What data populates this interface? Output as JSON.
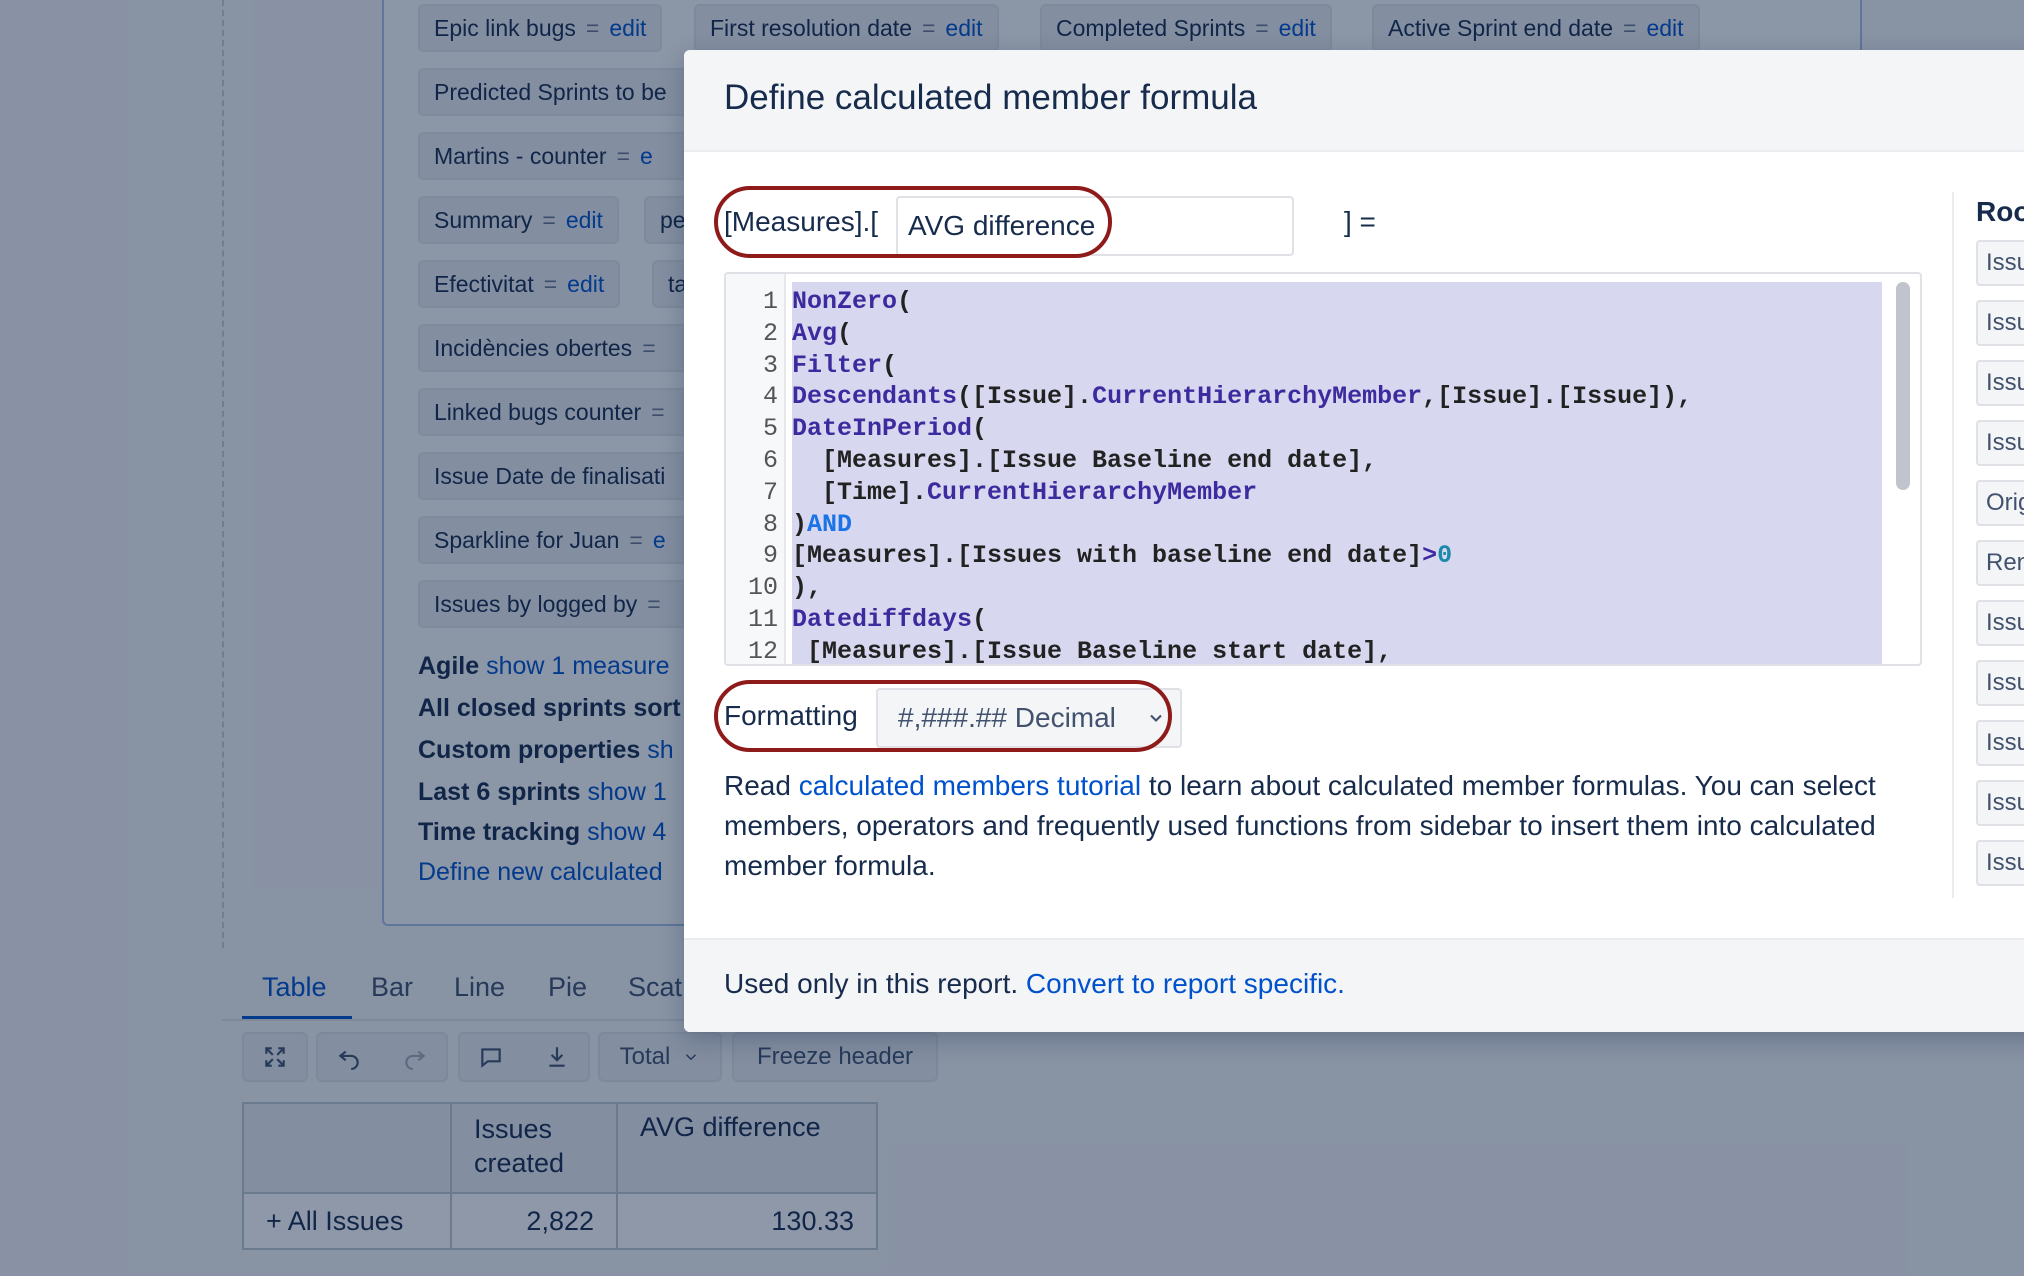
{
  "background": {
    "measure_chips": [
      {
        "label": "Epic link bugs",
        "edit": "edit"
      },
      {
        "label": "First resolution date",
        "edit": "edit"
      },
      {
        "label": "Completed Sprints",
        "edit": "edit"
      },
      {
        "label": "Active Sprint end date",
        "edit": "edit"
      },
      {
        "label": "Predicted Sprints to be"
      },
      {
        "label": "Martins - counter",
        "edit": "e"
      },
      {
        "label": "Summary",
        "edit": "edit"
      },
      {
        "label": "pe"
      },
      {
        "label": "Efectivitat",
        "edit": "edit"
      },
      {
        "label": "ta"
      },
      {
        "label": "Incidències obertes"
      },
      {
        "label": "Linked bugs counter"
      },
      {
        "label": "Issue Date de finalisati"
      },
      {
        "label": "Sparkline for Juan",
        "edit": "e"
      },
      {
        "label": "Issues by logged by"
      }
    ],
    "groups": [
      {
        "name": "Agile",
        "link": "show 1 measure"
      },
      {
        "name": "All closed sprints sort",
        "link": ""
      },
      {
        "name": "Custom properties",
        "link": "sh"
      },
      {
        "name": "Last 6 sprints",
        "link": "show 1"
      },
      {
        "name": "Time tracking",
        "link": "show 4"
      }
    ],
    "define_new": "Define new calculated",
    "tabs": [
      "Table",
      "Bar",
      "Line",
      "Pie",
      "Scat"
    ],
    "active_tab": "Table",
    "toolbar": {
      "total_label": "Total",
      "freeze_label": "Freeze header"
    },
    "table": {
      "headers": [
        "",
        "Issues\ncreated",
        "AVG difference"
      ],
      "rows": [
        [
          "+ All Issues",
          "2,822",
          "130.33"
        ]
      ]
    }
  },
  "modal": {
    "title": "Define calculated member formula",
    "prefix": "[Measures].[",
    "name_value": "AVG difference",
    "suffix": "] =",
    "code_lines": [
      [
        {
          "t": "NonZero",
          "c": "fn"
        },
        {
          "t": "("
        }
      ],
      [
        {
          "t": "Avg",
          "c": "fn"
        },
        {
          "t": "("
        }
      ],
      [
        {
          "t": "Filter",
          "c": "fn"
        },
        {
          "t": "("
        }
      ],
      [
        {
          "t": "Descendants",
          "c": "fn"
        },
        {
          "t": "([Issue]."
        },
        {
          "t": "CurrentHierarchyMember",
          "c": "fn"
        },
        {
          "t": ",[Issue].[Issue]),"
        }
      ],
      [
        {
          "t": "DateInPeriod",
          "c": "fn"
        },
        {
          "t": "("
        }
      ],
      [
        {
          "t": "  [Measures].[Issue Baseline end date],"
        }
      ],
      [
        {
          "t": "  [Time]."
        },
        {
          "t": "CurrentHierarchyMember",
          "c": "fn"
        }
      ],
      [
        {
          "t": ")"
        },
        {
          "t": "AND",
          "c": "kw"
        }
      ],
      [
        {
          "t": "[Measures].[Issues with baseline end date]"
        },
        {
          "t": ">",
          "c": "fn"
        },
        {
          "t": "0",
          "c": "nb"
        }
      ],
      [
        {
          "t": "),"
        }
      ],
      [
        {
          "t": "Datediffdays",
          "c": "fn"
        },
        {
          "t": "("
        }
      ],
      [
        {
          "t": " [Measures].[Issue Baseline start date],"
        }
      ]
    ],
    "formatting_label": "Formatting",
    "formatting_value": "#,###.## Decimal",
    "help_prefix": "Read ",
    "help_link": "calculated members tutorial",
    "help_suffix": " to learn about calculated member formulas. You can select members, operators and frequently used functions from sidebar to insert them into calculated member formula.",
    "footer_text": "Used only in this report.",
    "footer_link": "Convert to report specific.",
    "sidebar_title": "Roo",
    "sidebar_items": [
      "Issu",
      "Issu",
      "Issu",
      "Issu",
      "Orig",
      "Ren",
      "Issu",
      "Issu",
      "Issu",
      "Issu",
      "Issu"
    ]
  },
  "colors": {
    "link": "#0052cc",
    "highlight_ring": "#8e1a1a",
    "code_selection": "#d7d8ef",
    "code_function": "#3d2a9e",
    "code_keyword": "#1a73e8"
  }
}
